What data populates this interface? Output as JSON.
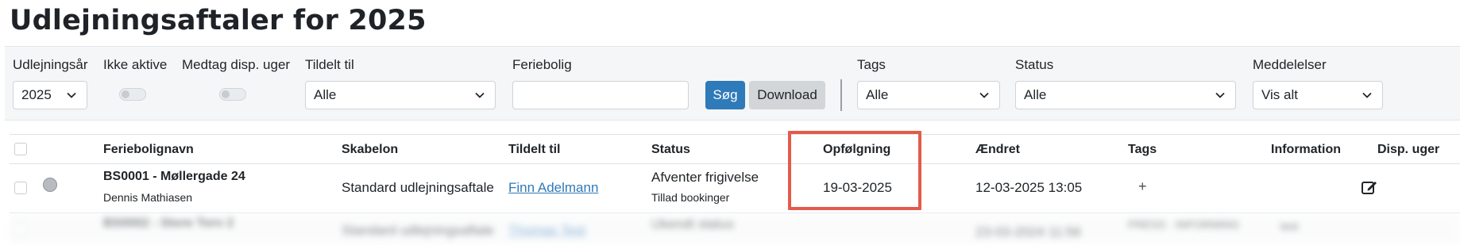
{
  "page_title": "Udlejningsaftaler for 2025",
  "filters": {
    "year": {
      "label": "Udlejningsår",
      "value": "2025"
    },
    "inactive": {
      "label": "Ikke aktive"
    },
    "disp_weeks": {
      "label": "Medtag disp. uger"
    },
    "assigned": {
      "label": "Tildelt til",
      "value": "Alle"
    },
    "holiday_home": {
      "label": "Feriebolig",
      "value": ""
    },
    "search_button": "Søg",
    "download_button": "Download",
    "tags": {
      "label": "Tags",
      "value": "Alle"
    },
    "status": {
      "label": "Status",
      "value": "Alle"
    },
    "messages": {
      "label": "Meddelelser",
      "value": "Vis alt"
    }
  },
  "table": {
    "headers": [
      "Feriebolignavn",
      "Skabelon",
      "Tildelt til",
      "Status",
      "Opfølgning",
      "Ændret",
      "Tags",
      "Information",
      "Disp. uger"
    ],
    "rows": [
      {
        "name": "BS0001 - Møllergade 24",
        "owner": "Dennis Mathiasen",
        "template": "Standard udlejningsaftale",
        "assigned": "Finn Adelmann",
        "status": "Afventer frigivelse",
        "status_sub": "Tillad bookinger",
        "followup": "19-03-2025",
        "changed": "12-03-2025 13:05",
        "tags": "+"
      },
      {
        "name": "BS0002 - Store Torv 2",
        "template": "Standard udlejningsaftale",
        "assigned": "Thomas Test",
        "status": "Ukendt status",
        "changed": "23-03-2024 11:56",
        "tags": "PRESS · INFORMING",
        "information": "test"
      }
    ]
  },
  "colors": {
    "primary": "#2f7ab9",
    "highlight": "#e35b4b"
  }
}
